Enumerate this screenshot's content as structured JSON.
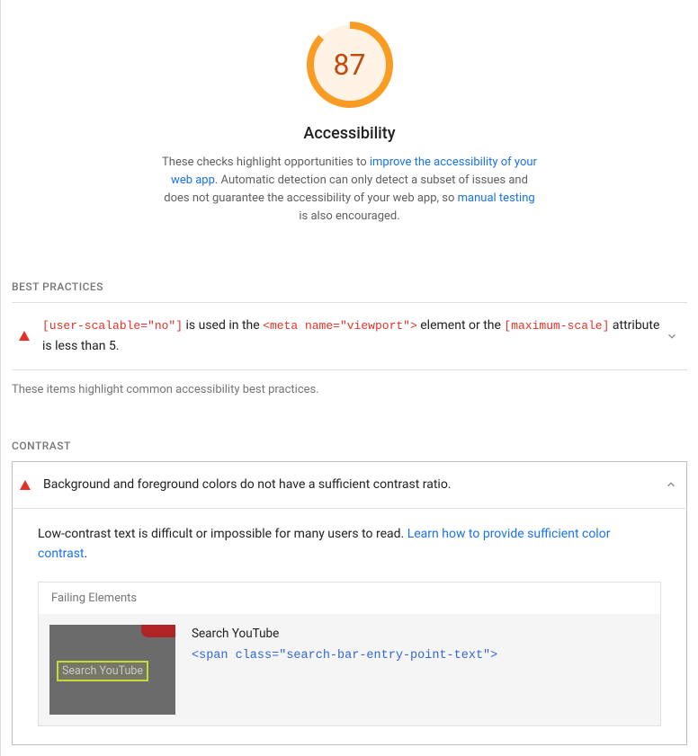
{
  "score": {
    "value": "87",
    "percent": 87,
    "title": "Accessibility"
  },
  "desc": {
    "t1": "These checks highlight opportunities to ",
    "link1": "improve the accessibility of your web app",
    "t2": ". Automatic detection can only detect a subset of issues and does not guarantee the accessibility of your web app, so ",
    "link2": "manual testing",
    "t3": " is also encouraged."
  },
  "best": {
    "label": "BEST PRACTICES",
    "c1": "[user-scalable=\"no\"]",
    "t1": " is used in the ",
    "c2": "<meta name=\"viewport\">",
    "t2": " element or the ",
    "c3": "[maximum-scale]",
    "t3": " attribute is less than 5.",
    "footnote": "These items highlight common accessibility best practices."
  },
  "contrast": {
    "label": "CONTRAST",
    "title": "Background and foreground colors do not have a sufficient contrast ratio.",
    "desc_t1": "Low-contrast text is difficult or impossible for many users to read. ",
    "desc_link": "Learn how to provide sufficient color contrast",
    "desc_t2": ".",
    "failing_label": "Failing Elements",
    "thumb_text": "Search YouTube",
    "el_name": "Search YouTube",
    "el_code": "<span class=\"search-bar-entry-point-text\">"
  }
}
